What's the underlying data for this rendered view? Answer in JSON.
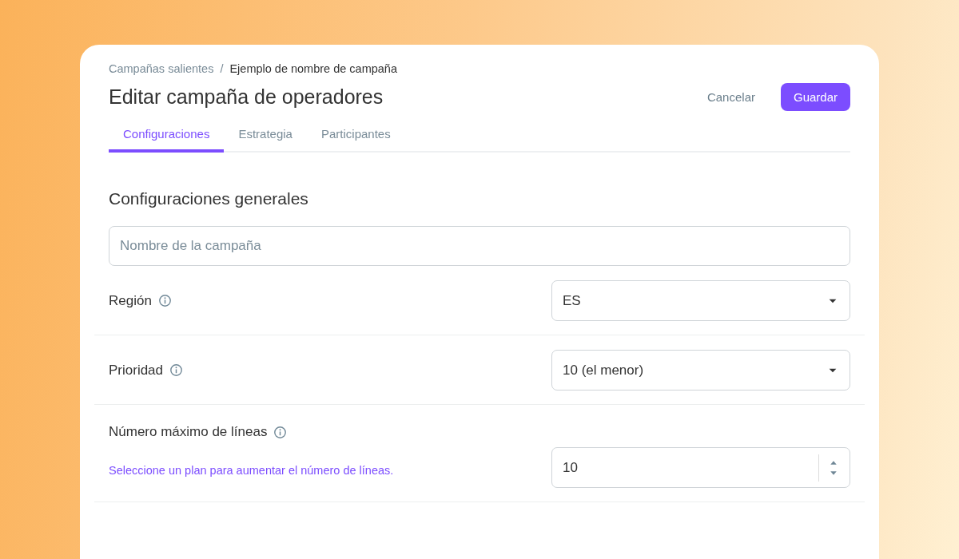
{
  "breadcrumb": [
    {
      "label": "Campañas salientes",
      "kind": "link"
    },
    {
      "label": "/",
      "kind": "separator"
    },
    {
      "label": "Ejemplo de nombre de campaña",
      "kind": "current"
    }
  ],
  "title": "Editar campaña de operadores",
  "actions": [
    {
      "label": "Cancelar",
      "kind": "secondary"
    },
    {
      "label": "Guardar",
      "kind": "primary"
    }
  ],
  "tabs": [
    {
      "label": "Configuraciones",
      "selected": true
    },
    {
      "label": "Estrategia",
      "selected": false
    },
    {
      "label": "Participantes",
      "selected": false
    }
  ],
  "section_title": "Configuraciones generales",
  "name_field": {
    "placeholder": "Nombre de la campaña"
  },
  "settings": [
    {
      "kind": "select",
      "label": "Región",
      "value": "ES"
    },
    {
      "kind": "select",
      "label": "Prioridad",
      "value": "10 (el menor)"
    },
    {
      "kind": "number",
      "label": "Número máximo de líneas",
      "hint": "Seleccione un plan para aumentar el número de líneas.",
      "value": "10"
    }
  ]
}
